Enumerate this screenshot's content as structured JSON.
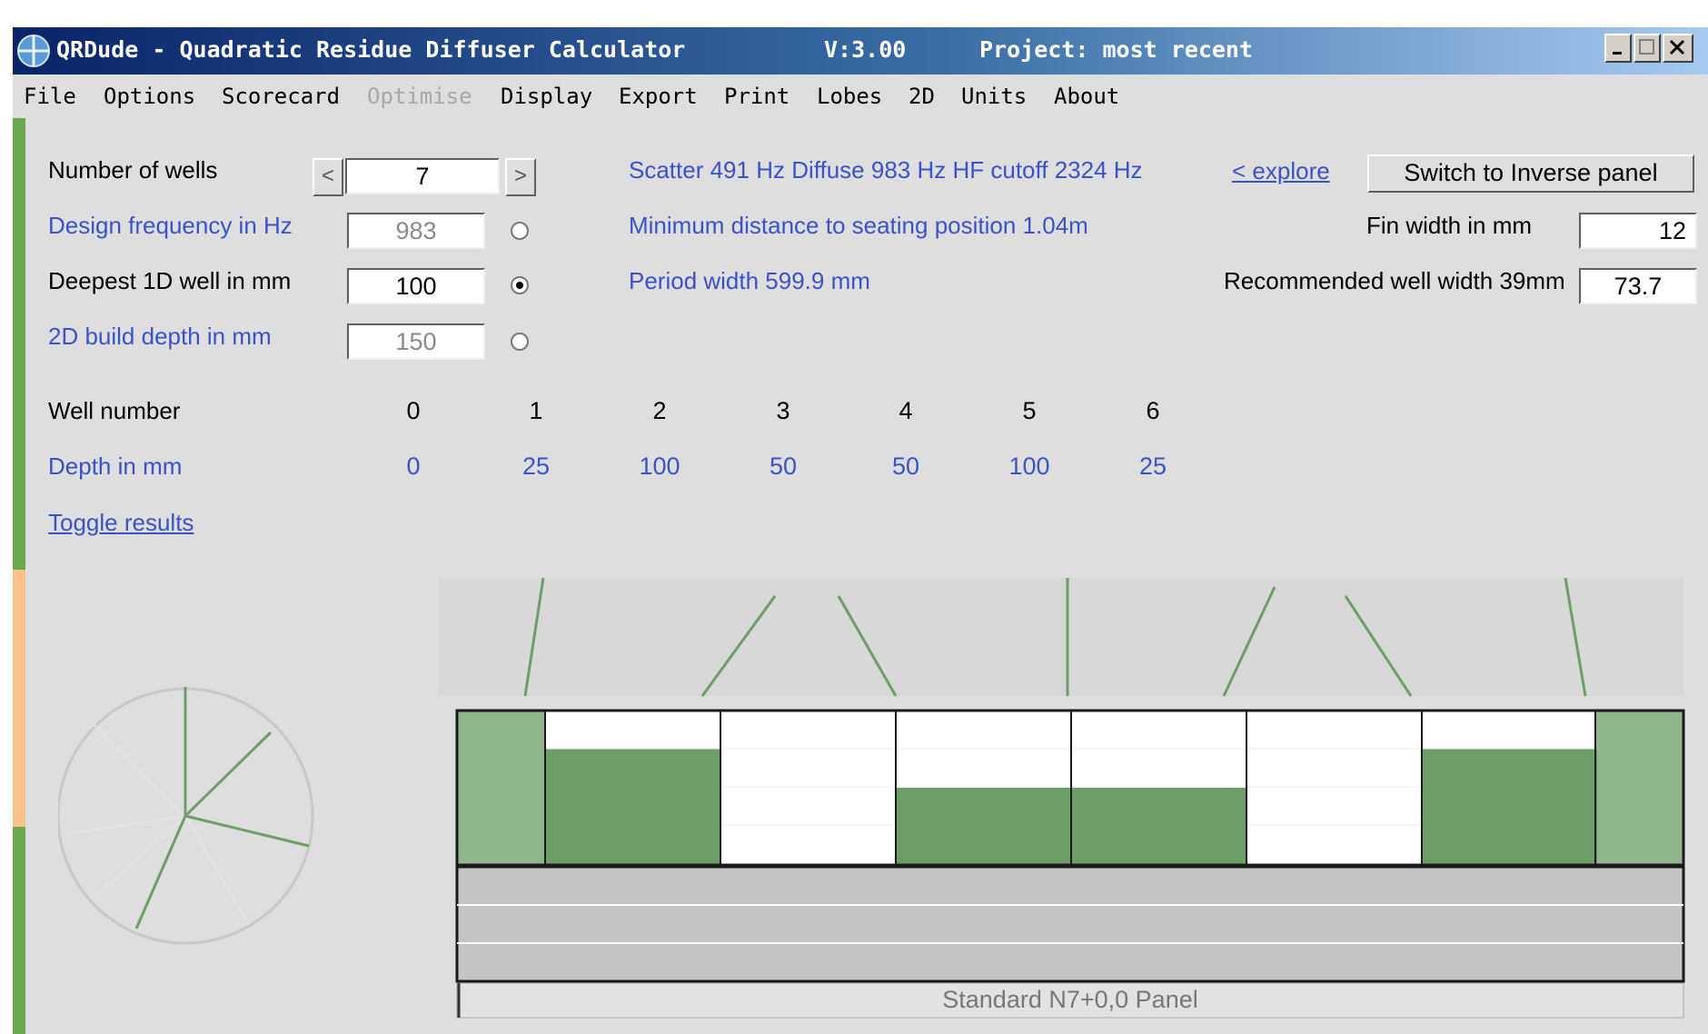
{
  "title_bar": {
    "title": "QRDude - Quadratic Residue Diffuser Calculator",
    "version": "V:3.00",
    "project": "Project: most recent",
    "controls": [
      "minimize",
      "maximize",
      "close"
    ]
  },
  "menu": [
    {
      "label": "File",
      "enabled": true
    },
    {
      "label": "Options",
      "enabled": true
    },
    {
      "label": "Scorecard",
      "enabled": true
    },
    {
      "label": "Optimise",
      "enabled": false
    },
    {
      "label": "Display",
      "enabled": true
    },
    {
      "label": "Export",
      "enabled": true
    },
    {
      "label": "Print",
      "enabled": true
    },
    {
      "label": "Lobes",
      "enabled": true
    },
    {
      "label": "2D",
      "enabled": true
    },
    {
      "label": "Units",
      "enabled": true
    },
    {
      "label": "About",
      "enabled": true
    }
  ],
  "form": {
    "num_wells_label": "Number of wells",
    "num_wells_value": "7",
    "spin_left": "<",
    "spin_right": ">",
    "design_freq_label": "Design frequency in Hz",
    "design_freq_value": "983",
    "deepest_label": "Deepest 1D well in mm",
    "deepest_value": "100",
    "build_depth_label": "2D build depth in mm",
    "build_depth_value": "150",
    "selected_radio": "deepest"
  },
  "info": {
    "freqs": "Scatter 491 Hz   Diffuse 983 Hz   HF cutoff 2324 Hz",
    "min_distance": "Minimum distance to seating position  1.04m",
    "period_width": "Period width  599.9 mm"
  },
  "right_panel": {
    "explore_link": "< explore",
    "switch_button": "Switch to Inverse panel",
    "fin_width_label": "Fin width in mm",
    "fin_width_value": "12",
    "rec_well_label": "Recommended well width  39mm",
    "rec_well_value": "73.7"
  },
  "wells": {
    "number_label": "Well number",
    "depth_label": "Depth in mm",
    "numbers": [
      "0",
      "1",
      "2",
      "3",
      "4",
      "5",
      "6"
    ],
    "depths": [
      "0",
      "25",
      "100",
      "50",
      "50",
      "100",
      "25"
    ]
  },
  "toggle_results": "Toggle results",
  "panel_caption": "Standard N7+0,0 Panel",
  "colors": {
    "well_green": "#6d9e67",
    "end_green": "#8fb58a",
    "titlebar_dark": "#0a246a",
    "link_blue": "#3a52c8",
    "sidebar_green": "#6aa84f",
    "sidebar_orange": "#f9c28a"
  }
}
